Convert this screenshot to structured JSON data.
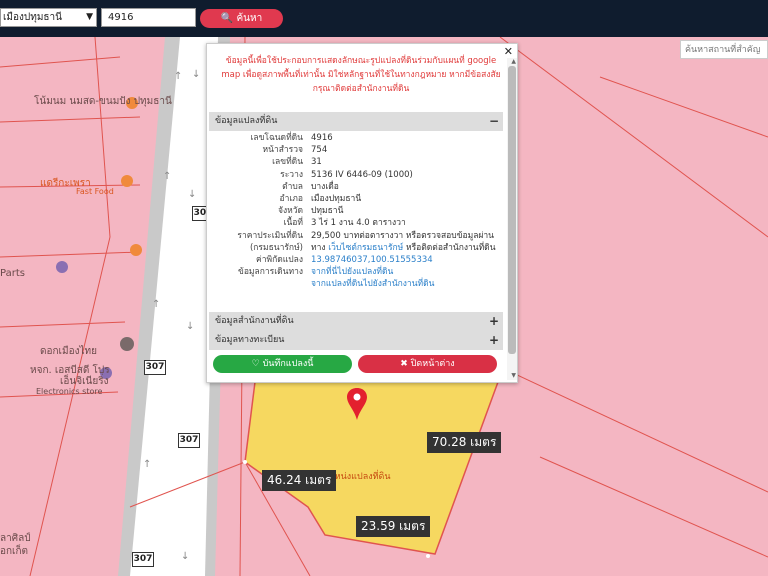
{
  "topbar": {
    "district_value": "เมืองปทุมธานี",
    "parcel_input_value": "4916",
    "search_label": "ค้นหา",
    "landmark_placeholder": "ค้นหาสถานที่สำคัญ"
  },
  "map": {
    "pois": [
      "โน้มนม นมสด-ขนมปัง ปทุมธานี",
      "แดรีกะเพรา",
      "Fast Food",
      "Parts",
      "ดอกเมืองไทย",
      "หจก. เอสบีสดี โปร",
      "เอ็นจิเนียริ่ง",
      "Electronics store",
      "ลาศิลป์",
      "อกเก็ต"
    ],
    "road_shields": [
      "307",
      "307",
      "307",
      "307"
    ],
    "marker_label": "ตำแหน่งแปลงที่ดิน",
    "measurements": {
      "m1": "70.28 เมตร",
      "m2": "46.24 เมตร",
      "m3": "23.59 เมตร"
    },
    "colors": {
      "background": "#f4b6c2",
      "parcel_fill": "#f6d860",
      "parcel_boundary": "#e0544f",
      "marker": "#e3202e"
    }
  },
  "popup": {
    "notice": "ข้อมูลนี้เพื่อใช้ประกอบการแสดงลักษณะรูปแปลงที่ดินร่วมกับแผนที่ google map เพื่อดูสภาพพื้นที่เท่านั้น มิใช่หลักฐานที่ใช้ในทางกฎหมาย หากมีข้อสงสัยกรุณาติดต่อสำนักงานที่ดิน",
    "section_parcel": "ข้อมูลแปลงที่ดิน",
    "rows": [
      {
        "label": "เลขโฉนดที่ดิน",
        "value": "4916"
      },
      {
        "label": "หน้าสำรวจ",
        "value": "754"
      },
      {
        "label": "เลขที่ดิน",
        "value": "31"
      },
      {
        "label": "ระวาง",
        "value": "5136 IV 6446-09 (1000)"
      },
      {
        "label": "ตำบล",
        "value": "บางเดื่อ"
      },
      {
        "label": "อำเภอ",
        "value": "เมืองปทุมธานี"
      },
      {
        "label": "จังหวัด",
        "value": "ปทุมธานี"
      },
      {
        "label": "เนื้อที่",
        "value": "3 ไร่ 1 งาน 4.0 ตารางวา"
      },
      {
        "label": "ราคาประเมินที่ดิน",
        "value": "29,500 บาทต่อตารางวา หรือตรวจสอบข้อมูลผ่าน"
      },
      {
        "label": "(กรมธนารักษ์)",
        "value_prefix": "ทาง",
        "value_link": "เว็บไซต์กรมธนารักษ์",
        "value_suffix": "หรือติดต่อสำนักงานที่ดิน"
      },
      {
        "label": "ค่าพิกัดแปลง",
        "value": "13.98746037,100.51555334"
      },
      {
        "label": "ข้อมูลการเดินทาง",
        "value": "จากที่นี่ไปยังแปลงที่ดิน"
      },
      {
        "label": "",
        "value": "จากแปลงที่ดินไปยังสำนักงานที่ดิน"
      }
    ],
    "section_office": "ข้อมูลสำนักงานที่ดิน",
    "section_registry": "ข้อมูลทางทะเบียน",
    "save_label": "บันทึกแปลงนี้",
    "close_label": "ปิดหน้าต่าง"
  }
}
